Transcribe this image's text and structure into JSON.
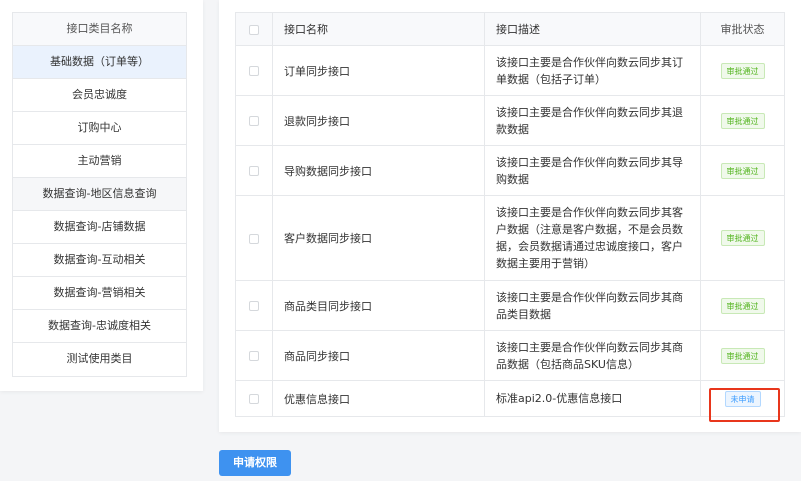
{
  "categories": {
    "header": "接口类目名称",
    "items": [
      {
        "label": "基础数据（订单等）"
      },
      {
        "label": "会员忠诚度"
      },
      {
        "label": "订购中心"
      },
      {
        "label": "主动营销"
      },
      {
        "label": "数据查询-地区信息查询"
      },
      {
        "label": "数据查询-店铺数据"
      },
      {
        "label": "数据查询-互动相关"
      },
      {
        "label": "数据查询-营销相关"
      },
      {
        "label": "数据查询-忠诚度相关"
      },
      {
        "label": "测试使用类目"
      }
    ]
  },
  "api_table": {
    "headers": {
      "name": "接口名称",
      "desc": "接口描述",
      "status": "审批状态"
    },
    "rows": [
      {
        "name": "订单同步接口",
        "desc": "该接口主要是合作伙伴向数云同步其订单数据（包括子订单）",
        "status": "审批通过",
        "state": "approved"
      },
      {
        "name": "退款同步接口",
        "desc": "该接口主要是合作伙伴向数云同步其退款数据",
        "status": "审批通过",
        "state": "approved"
      },
      {
        "name": "导购数据同步接口",
        "desc": "该接口主要是合作伙伴向数云同步其导购数据",
        "status": "审批通过",
        "state": "approved"
      },
      {
        "name": "客户数据同步接口",
        "desc": "该接口主要是合作伙伴向数云同步其客户数据（注意是客户数据，不是会员数据，会员数据请通过忠诚度接口，客户数据主要用于营销）",
        "status": "审批通过",
        "state": "approved"
      },
      {
        "name": "商品类目同步接口",
        "desc": "该接口主要是合作伙伴向数云同步其商品类目数据",
        "status": "审批通过",
        "state": "approved"
      },
      {
        "name": "商品同步接口",
        "desc": "该接口主要是合作伙伴向数云同步其商品数据（包括商品SKU信息）",
        "status": "审批通过",
        "state": "approved"
      },
      {
        "name": "优惠信息接口",
        "desc": "标准api2.0-优惠信息接口",
        "status": "未申请",
        "state": "not-applied"
      }
    ]
  },
  "apply_button": "申请权限",
  "colors": {
    "accent": "#3e92f0",
    "approved": "#52b41e",
    "pending": "#409eff",
    "highlight": "#e8361c"
  }
}
